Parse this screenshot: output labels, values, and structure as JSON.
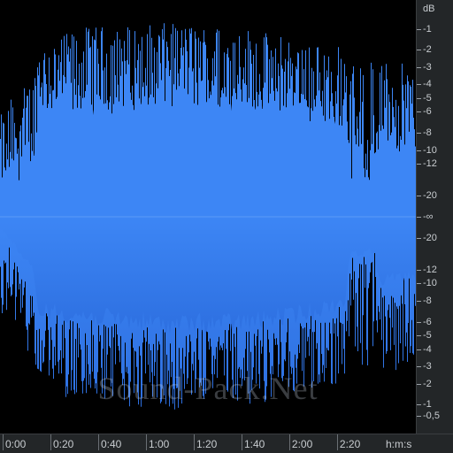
{
  "waveform": {
    "color": "#3d86f5",
    "color_dark": "#2d6fe0",
    "background": "#000000",
    "envelope_key": [
      {
        "t": 0.0,
        "peak": 0.48,
        "body": 0.05
      },
      {
        "t": 0.03,
        "peak": 0.58,
        "body": 0.12
      },
      {
        "t": 0.08,
        "peak": 0.66,
        "body": 0.26
      },
      {
        "t": 0.09,
        "peak": 0.82,
        "body": 0.44
      },
      {
        "t": 0.2,
        "peak": 0.9,
        "body": 0.47
      },
      {
        "t": 0.4,
        "peak": 0.92,
        "body": 0.51
      },
      {
        "t": 0.6,
        "peak": 0.9,
        "body": 0.5
      },
      {
        "t": 0.75,
        "peak": 0.82,
        "body": 0.45
      },
      {
        "t": 0.83,
        "peak": 0.82,
        "body": 0.4
      },
      {
        "t": 0.84,
        "peak": 0.72,
        "body": 0.18
      },
      {
        "t": 0.9,
        "peak": 0.76,
        "body": 0.16
      },
      {
        "t": 0.91,
        "peak": 0.74,
        "body": 0.3
      },
      {
        "t": 1.0,
        "peak": 0.72,
        "body": 0.28
      }
    ]
  },
  "db_ruler": {
    "unit": "dB",
    "labels": [
      {
        "text": "-1",
        "level": 0.891
      },
      {
        "text": "-2",
        "level": 0.794
      },
      {
        "text": "-3",
        "level": 0.708
      },
      {
        "text": "-4",
        "level": 0.631
      },
      {
        "text": "-5",
        "level": 0.562
      },
      {
        "text": "-6",
        "level": 0.501
      },
      {
        "text": "-8",
        "level": 0.398
      },
      {
        "text": "-10",
        "level": 0.316
      },
      {
        "text": "-12",
        "level": 0.251
      },
      {
        "text": "-20",
        "level": 0.1
      },
      {
        "text": "-∞",
        "level": 0.0
      },
      {
        "text": "-20",
        "level": -0.1
      },
      {
        "text": "-12",
        "level": -0.251
      },
      {
        "text": "-10",
        "level": -0.316
      },
      {
        "text": "-8",
        "level": -0.398
      },
      {
        "text": "-6",
        "level": -0.501
      },
      {
        "text": "-5",
        "level": -0.562
      },
      {
        "text": "-4",
        "level": -0.631
      },
      {
        "text": "-3",
        "level": -0.708
      },
      {
        "text": "-2",
        "level": -0.794
      },
      {
        "text": "-1",
        "level": -0.891
      },
      {
        "text": "-0,5",
        "level": -0.944
      }
    ]
  },
  "time_ruler": {
    "unit": "h:m:s",
    "ticks": [
      {
        "text": "0:00",
        "seconds": 0
      },
      {
        "text": "0:20",
        "seconds": 20
      },
      {
        "text": "0:40",
        "seconds": 40
      },
      {
        "text": "1:00",
        "seconds": 60
      },
      {
        "text": "1:20",
        "seconds": 80
      },
      {
        "text": "1:40",
        "seconds": 100
      },
      {
        "text": "2:00",
        "seconds": 120
      },
      {
        "text": "2:20",
        "seconds": 140
      }
    ],
    "visible_seconds": 173
  },
  "watermark": "Sound-Pack.Net"
}
